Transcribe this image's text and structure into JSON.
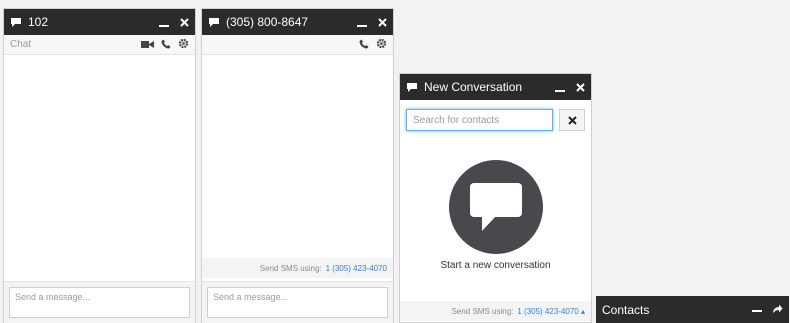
{
  "windows": {
    "chat_102": {
      "title": "102",
      "toolbar_label": "Chat",
      "message_placeholder": "Send a message..."
    },
    "chat_phone": {
      "title": "(305) 800-8647",
      "sms_label": "Send SMS using:",
      "sms_number": "1 (305) 423-4070",
      "message_placeholder": "Send a message..."
    },
    "new_conversation": {
      "title": "New Conversation",
      "search_placeholder": "Search for contacts",
      "start_text": "Start a new conversation",
      "sms_label": "Send SMS using:",
      "sms_number": "1 (305) 423-4070 ▴"
    },
    "contacts": {
      "title": "Contacts"
    }
  },
  "colors": {
    "title_bar": "#2b2b2d",
    "link_blue": "#3a7fd0",
    "bubble": "#47494d"
  },
  "icons": [
    "chat-bubble-icon",
    "minimize-icon",
    "close-icon",
    "video-camera-icon",
    "phone-icon",
    "gear-icon",
    "expand-arrow-icon"
  ]
}
